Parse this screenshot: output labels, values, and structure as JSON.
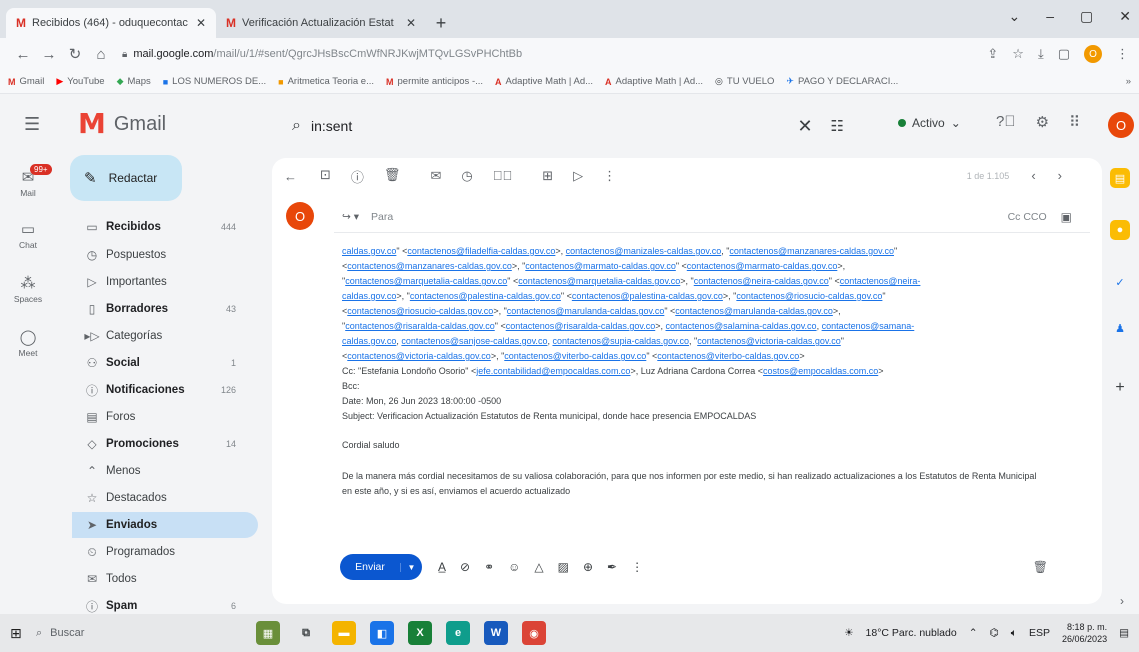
{
  "browser": {
    "tabs": [
      {
        "title": "Recibidos (464) - oduquecontac",
        "active": true
      },
      {
        "title": "Verificación Actualización Estat",
        "active": false
      }
    ],
    "new_tab": "+",
    "window_controls": [
      "⌄",
      "–",
      "▢",
      "✕"
    ],
    "url_host": "mail.google.com",
    "url_rest": "/mail/u/1/#sent/QgrcJHsBscCmWfNRJKwjMTQvLGSvPHChtBb",
    "bookmarks": [
      {
        "label": "Gmail",
        "icon": "M",
        "color": "#d93025"
      },
      {
        "label": "YouTube",
        "icon": "▶",
        "color": "#ff0000"
      },
      {
        "label": "Maps",
        "icon": "◆",
        "color": "#34a853"
      },
      {
        "label": "LOS NUMEROS DE...",
        "icon": "■",
        "color": "#1a73e8"
      },
      {
        "label": "Aritmetica Teoria e...",
        "icon": "■",
        "color": "#f29900"
      },
      {
        "label": "permite anticipos -...",
        "icon": "M",
        "color": "#d93025"
      },
      {
        "label": "Adaptive Math | Ad...",
        "icon": "A",
        "color": "#d93025"
      },
      {
        "label": "Adaptive Math | Ad...",
        "icon": "A",
        "color": "#d93025"
      },
      {
        "label": "TU VUELO",
        "icon": "◎",
        "color": "#3c4043"
      },
      {
        "label": "PAGO Y DECLARACI...",
        "icon": "✈",
        "color": "#1a73e8"
      }
    ],
    "more_bookmarks": "»"
  },
  "gmail": {
    "app_name": "Gmail",
    "search_value": "in:sent",
    "status_label": "Activo",
    "account_initial": "O"
  },
  "rail": [
    {
      "label": "Mail",
      "icon": "✉",
      "badge": "99+"
    },
    {
      "label": "Chat",
      "icon": "▭"
    },
    {
      "label": "Spaces",
      "icon": "⁂"
    },
    {
      "label": "Meet",
      "icon": "◯"
    }
  ],
  "sidebar": {
    "compose_label": "Redactar",
    "items": [
      {
        "label": "Recibidos",
        "icon": "▭",
        "count": "444",
        "bold": true
      },
      {
        "label": "Pospuestos",
        "icon": "◷",
        "count": "",
        "bold": false
      },
      {
        "label": "Importantes",
        "icon": "▷",
        "count": "",
        "bold": false
      },
      {
        "label": "Borradores",
        "icon": "▯",
        "count": "43",
        "bold": true
      },
      {
        "label": "Categorías",
        "icon": "▸▷",
        "count": "",
        "bold": false
      },
      {
        "label": "Social",
        "icon": "⚇",
        "count": "1",
        "bold": true
      },
      {
        "label": "Notificaciones",
        "icon": "ⓘ",
        "count": "126",
        "bold": true
      },
      {
        "label": "Foros",
        "icon": "▤",
        "count": "",
        "bold": false
      },
      {
        "label": "Promociones",
        "icon": "◇",
        "count": "14",
        "bold": true
      },
      {
        "label": "Menos",
        "icon": "⌃",
        "count": "",
        "bold": false
      },
      {
        "label": "Destacados",
        "icon": "☆",
        "count": "",
        "bold": false
      },
      {
        "label": "Enviados",
        "icon": "➤",
        "count": "",
        "bold": false,
        "active": true
      },
      {
        "label": "Programados",
        "icon": "⏲",
        "count": "",
        "bold": false
      },
      {
        "label": "Todos",
        "icon": "✉",
        "count": "",
        "bold": false
      },
      {
        "label": "Spam",
        "icon": "ⓘ",
        "count": "6",
        "bold": true
      }
    ]
  },
  "toolbar": {
    "back": "←",
    "pager": "1 de 1.105",
    "prev": "‹",
    "next": "›"
  },
  "compose": {
    "sender_initial": "O",
    "to_label": "Para",
    "cc_bcc": "Cc CCO",
    "recipient_lines": [
      "caldas.gov.co\" <contactenos@filadelfia-caldas.gov.co>, contactenos@manizales-caldas.gov.co, \"contactenos@manzanares-caldas.gov.co\"",
      "<contactenos@manzanares-caldas.gov.co>, \"contactenos@marmato-caldas.gov.co\" <contactenos@marmato-caldas.gov.co>,",
      "\"contactenos@marquetalia-caldas.gov.co\" <contactenos@marquetalia-caldas.gov.co>, \"contactenos@neira-caldas.gov.co\" <contactenos@neira-",
      "caldas.gov.co>, \"contactenos@palestina-caldas.gov.co\" <contactenos@palestina-caldas.gov.co>, \"contactenos@riosucio-caldas.gov.co\"",
      "<contactenos@riosucio-caldas.gov.co>, \"contactenos@marulanda-caldas.gov.co\" <contactenos@marulanda-caldas.gov.co>,",
      "\"contactenos@risaralda-caldas.gov.co\" <contactenos@risaralda-caldas.gov.co>, contactenos@salamina-caldas.gov.co, contactenos@samana-",
      "caldas.gov.co, contactenos@sanjose-caldas.gov.co, contactenos@supia-caldas.gov.co, \"contactenos@victoria-caldas.gov.co\"",
      "<contactenos@victoria-caldas.gov.co>, \"contactenos@viterbo-caldas.gov.co\" <contactenos@viterbo-caldas.gov.co>"
    ],
    "cc_line_prefix": "Cc: \"Estefania Londoño Osorio\" <",
    "cc_link1": "jefe.contabilidad@empocaldas.com.co",
    "cc_line_mid": ">, Luz Adriana Cardona Correa <",
    "cc_link2": "costos@empocaldas.com.co",
    "cc_line_end": ">",
    "bcc_line": "Bcc:",
    "date_line": "Date: Mon, 26 Jun 2023 18:00:00 -0500",
    "subject_line": "Subject: Verificacion Actualización Estatutos de Renta municipal, donde hace presencia EMPOCALDAS",
    "greeting": "Cordial saludo",
    "paragraph": "De la manera más cordial necesitamos de su valiosa colaboración, para que nos informen por este medio, si han realizado actualizaciones a los Estatutos de Renta Municipal en este año, y si es así, enviamos el acuerdo actualizado",
    "send_label": "Enviar"
  },
  "taskbar": {
    "search_label": "Buscar",
    "weather": "18°C  Parc. nublado",
    "lang": "ESP",
    "time": "8:18 p. m.",
    "date": "26/06/2023"
  },
  "colors": {
    "accent": "#0b57d0",
    "avatar": "#e8470a",
    "active_nav": "#c8e0f5"
  }
}
